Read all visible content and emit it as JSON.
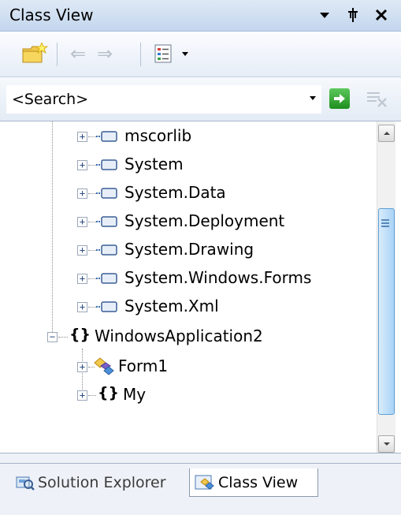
{
  "window": {
    "title": "Class View",
    "dropdown_glyph": "▾",
    "pin_glyph": "ᛠ",
    "close_glyph": "×"
  },
  "toolbar": {
    "new_folder_icon": "new-folder-icon",
    "back_glyph": "⇐",
    "forward_glyph": "⇒",
    "settings_icon": "class-view-settings-icon",
    "settings_drop_glyph": "▾"
  },
  "search": {
    "value": "<Search>",
    "drop_glyph": "▾",
    "go_glyph": "➜"
  },
  "tree": {
    "items": [
      {
        "label": "mscorlib",
        "kind": "reference"
      },
      {
        "label": "System",
        "kind": "reference"
      },
      {
        "label": "System.Data",
        "kind": "reference"
      },
      {
        "label": "System.Deployment",
        "kind": "reference"
      },
      {
        "label": "System.Drawing",
        "kind": "reference"
      },
      {
        "label": "System.Windows.Forms",
        "kind": "reference"
      },
      {
        "label": "System.Xml",
        "kind": "reference"
      },
      {
        "label": "WindowsApplication2",
        "kind": "namespace",
        "expanded": true
      },
      {
        "label": "Form1",
        "kind": "class"
      },
      {
        "label": "My",
        "kind": "namespace"
      }
    ],
    "expand_glyph": "+",
    "collapse_glyph": "−",
    "namespace_glyph": "{}"
  },
  "tabs": [
    {
      "label": "Solution Explorer",
      "active": false
    },
    {
      "label": "Class View",
      "active": true
    }
  ],
  "colors": {
    "title_bg": "#c3d6ee",
    "scroll_thumb": "#a9d3f5",
    "go_green": "#1e8e1e"
  }
}
